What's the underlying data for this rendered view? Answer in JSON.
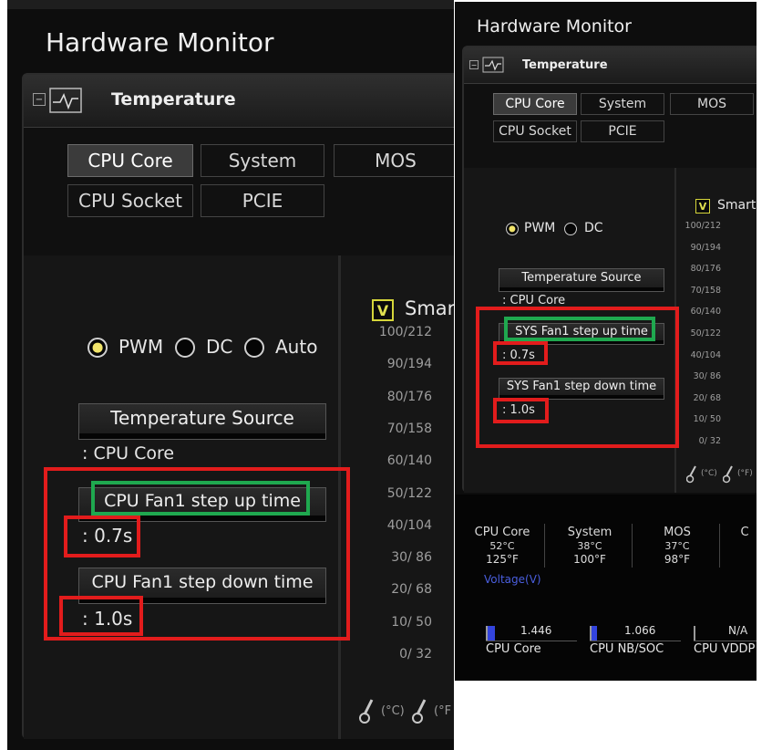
{
  "left": {
    "window_title": "Hardware Monitor",
    "section_title": "Temperature",
    "tabs": [
      {
        "label": "CPU Core",
        "active": true
      },
      {
        "label": "System",
        "active": false
      },
      {
        "label": "MOS",
        "active": false
      },
      {
        "label": "CPU Socket",
        "active": false
      },
      {
        "label": "PCIE",
        "active": false
      }
    ],
    "modes": {
      "pwm": "PWM",
      "dc": "DC",
      "auto": "Auto",
      "selected": "PWM"
    },
    "temp_source_button": "Temperature Source",
    "temp_source_value": ": CPU Core",
    "step_up_button": "CPU Fan1 step up time",
    "step_up_value": ": 0.7s",
    "step_down_button": "CPU Fan1 step down time",
    "step_down_value": ": 1.0s",
    "smart_label": "Smar",
    "smart_checked": "V",
    "axis": [
      "100/212",
      "90/194",
      "80/176",
      "70/158",
      "60/140",
      "50/122",
      "40/104",
      "30/ 86",
      "20/ 68",
      "10/ 50",
      "0/ 32"
    ],
    "unit_celsius": "(°C)",
    "unit_fahrenheit": "(°F"
  },
  "right": {
    "window_title": "Hardware Monitor",
    "section_title": "Temperature",
    "tabs": [
      {
        "label": "CPU Core",
        "active": true
      },
      {
        "label": "System",
        "active": false
      },
      {
        "label": "MOS",
        "active": false
      },
      {
        "label": "CPU Socket",
        "active": false
      },
      {
        "label": "PCIE",
        "active": false
      }
    ],
    "modes": {
      "pwm": "PWM",
      "dc": "DC",
      "selected": "PWM"
    },
    "temp_source_button": "Temperature Source",
    "temp_source_value": ": CPU Core",
    "step_up_button": "SYS Fan1 step up time",
    "step_up_value": ": 0.7s",
    "step_down_button": "SYS Fan1 step down time",
    "step_down_value": ": 1.0s",
    "smart_label": "Smart",
    "smart_checked": "V",
    "axis": [
      "100/212",
      "90/194",
      "80/176",
      "70/158",
      "60/140",
      "50/122",
      "40/104",
      "30/ 86",
      "20/ 68",
      "10/ 50",
      "0/ 32"
    ],
    "unit_celsius": "(°C)",
    "unit_fahrenheit": "(°F)",
    "readouts": [
      {
        "name": "CPU Core",
        "c": "52°C",
        "f": "125°F"
      },
      {
        "name": "System",
        "c": "38°C",
        "f": "100°F"
      },
      {
        "name": "MOS",
        "c": "37°C",
        "f": "98°F"
      },
      {
        "name": "C",
        "c": "",
        "f": ""
      }
    ],
    "voltage_label": "Voltage(V)",
    "voltages": [
      {
        "name": "CPU Core",
        "value": "1.446",
        "level": 0.25
      },
      {
        "name": "CPU NB/SOC",
        "value": "1.066",
        "level": 0.2
      },
      {
        "name": "CPU VDDP",
        "value": "N/A",
        "level": 0
      }
    ]
  },
  "colors": {
    "highlight_red": "#e21c1c",
    "highlight_green": "#1fa84f",
    "radio_on": "#f1e46a",
    "voltage_bar": "#3344dd"
  }
}
